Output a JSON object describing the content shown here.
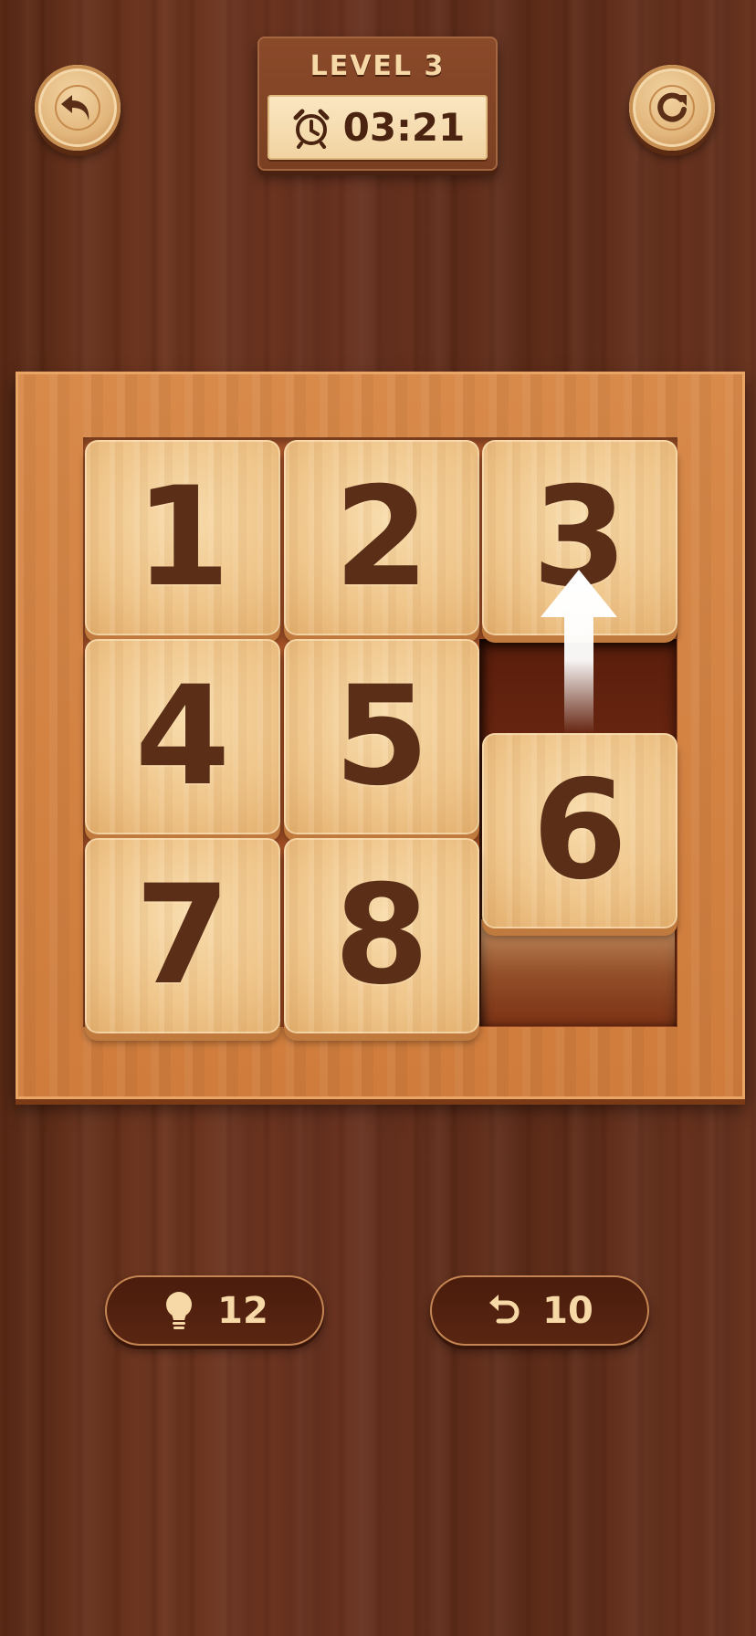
{
  "header": {
    "level_label": "LEVEL 3",
    "timer": "03:21",
    "back_icon": "back-arrow-icon",
    "restart_icon": "restart-icon",
    "timer_icon": "alarm-clock-icon"
  },
  "board": {
    "size": "3x3",
    "tiles": [
      "1",
      "2",
      "3",
      "4",
      "5",
      "6",
      "7",
      "8"
    ],
    "empty_cell": "row 3, column 3",
    "hint": {
      "tile": "6",
      "direction": "up",
      "icon": "hint-arrow-up-icon"
    }
  },
  "footer": {
    "hints_count": "12",
    "hints_icon": "lightbulb-icon",
    "undo_count": "10",
    "undo_icon": "undo-arrow-icon"
  },
  "colors": {
    "background_wood": "#693220",
    "board_wood": "#d88a4a",
    "tile_wood": "#f3cf97",
    "tile_number": "#5b2f17",
    "accent_text": "#f6d9a6"
  }
}
